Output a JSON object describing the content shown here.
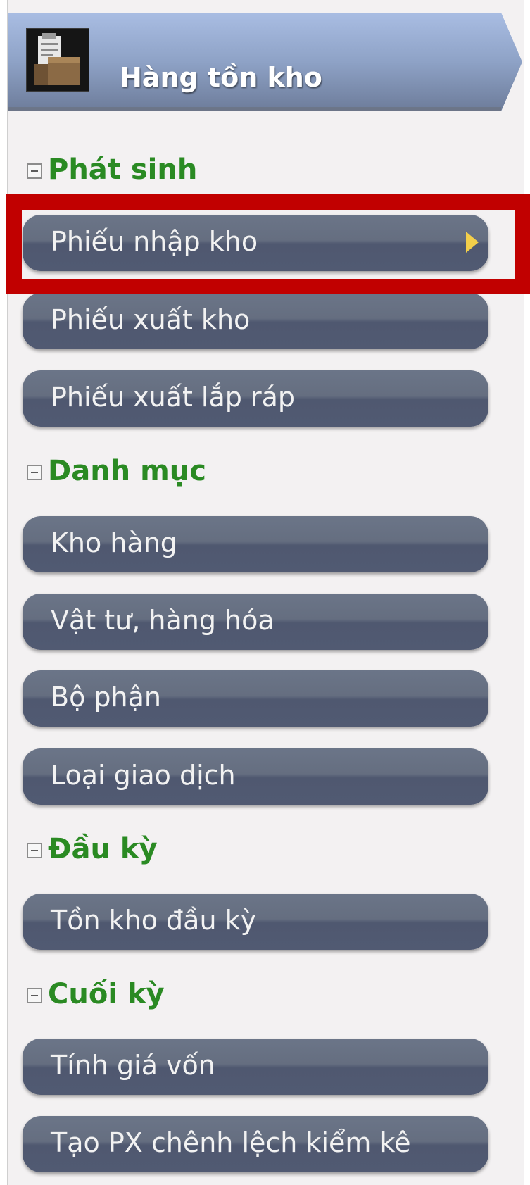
{
  "header": {
    "title": "Hàng tồn kho",
    "icon": "warehouse-clipboard-icon"
  },
  "sections": [
    {
      "label": "Phát sinh",
      "items": [
        "Phiếu nhập kho",
        "Phiếu xuất kho",
        "Phiếu xuất lắp ráp"
      ]
    },
    {
      "label": "Danh mục",
      "items": [
        "Kho hàng",
        "Vật tư, hàng hóa",
        "Bộ phận",
        "Loại giao dịch"
      ]
    },
    {
      "label": "Đầu kỳ",
      "items": [
        "Tồn kho đầu kỳ"
      ]
    },
    {
      "label": "Cuối kỳ",
      "items": [
        "Tính giá vốn",
        "Tạo PX chênh lệch kiểm kê"
      ]
    }
  ],
  "colors": {
    "section_text": "#2a8a23",
    "button_bg": "#5e687c",
    "highlight": "#c10000",
    "arrow": "#f3cf4a"
  }
}
